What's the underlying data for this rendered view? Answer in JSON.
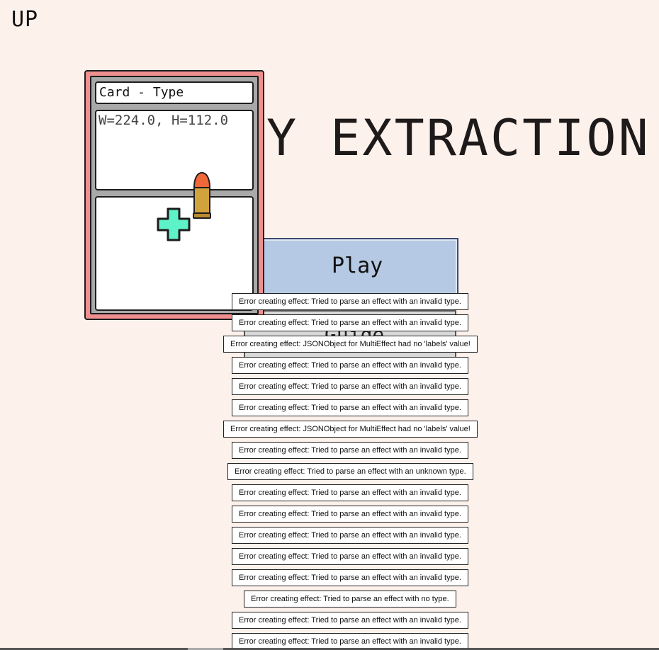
{
  "screen": {
    "corner_label": "UP",
    "title": "Y EXTRACTION"
  },
  "menu": {
    "play_label": "Play",
    "secondary_label": "Guide"
  },
  "card": {
    "type_label": "Card - Type",
    "dimensions_text": "W=224.0, H=112.0",
    "art_icons": [
      "plus-icon",
      "bullet-icon"
    ]
  },
  "colors": {
    "background": "#fdf1ec",
    "card_border": "#f08f8f",
    "play_button": "#b6c9e4",
    "plus_icon": "#5ef2c8",
    "bullet_tip": "#f0683a",
    "bullet_case": "#d2a23c"
  },
  "errors": [
    "Error creating effect: Tried to parse an effect with an invalid type.",
    "Error creating effect: Tried to parse an effect with an invalid type.",
    "Error creating effect: JSONObject for MultiEffect had no 'labels' value!",
    "Error creating effect: Tried to parse an effect with an invalid type.",
    "Error creating effect: Tried to parse an effect with an invalid type.",
    "Error creating effect: Tried to parse an effect with an invalid type.",
    "Error creating effect: JSONObject for MultiEffect had no 'labels' value!",
    "Error creating effect: Tried to parse an effect with an invalid type.",
    "Error creating effect: Tried to parse an effect with an unknown type.",
    "Error creating effect: Tried to parse an effect with an invalid type.",
    "Error creating effect: Tried to parse an effect with an invalid type.",
    "Error creating effect: Tried to parse an effect with an invalid type.",
    "Error creating effect: Tried to parse an effect with an invalid type.",
    "Error creating effect: Tried to parse an effect with an invalid type.",
    "Error creating effect: Tried to parse an effect with no type.",
    "Error creating effect: Tried to parse an effect with an invalid type.",
    "Error creating effect: Tried to parse an effect with an invalid type."
  ]
}
